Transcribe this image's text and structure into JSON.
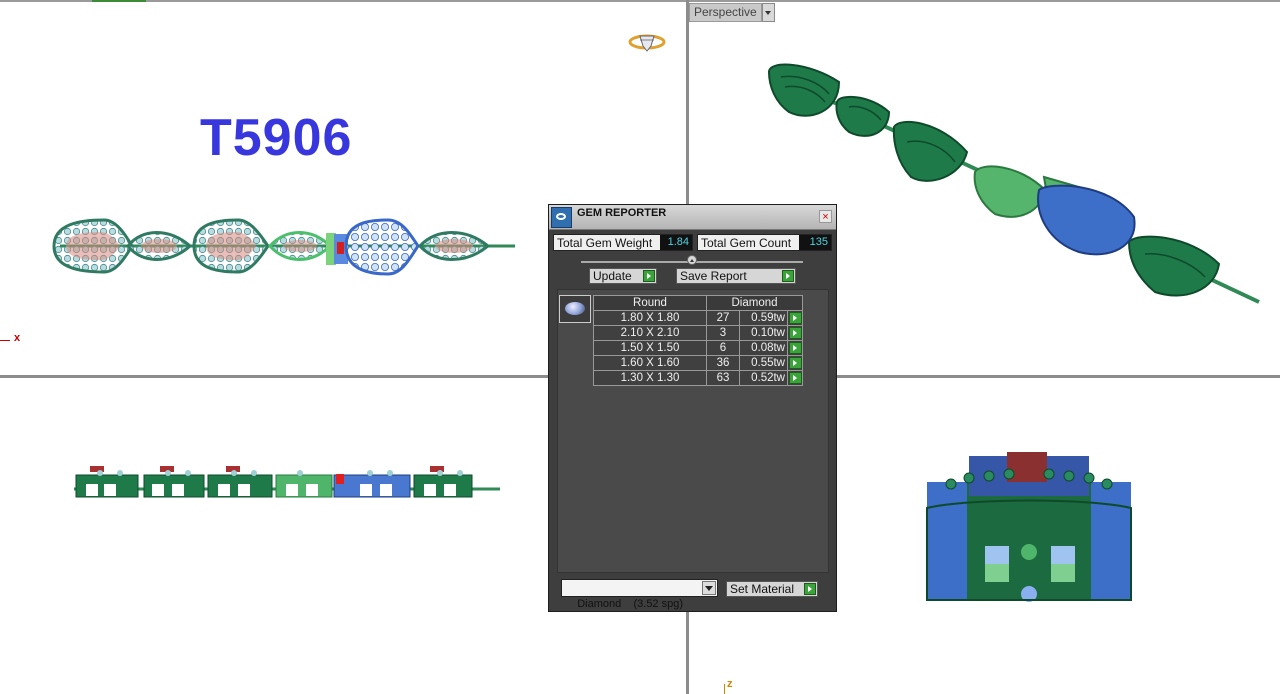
{
  "viewport_top_right": {
    "label": "Perspective"
  },
  "viewport_top_left": {
    "model_label": "T5906",
    "axis_label": "x"
  },
  "viewport_bottom_right": {
    "axis_label": "z"
  },
  "gem_reporter": {
    "title": "GEM REPORTER",
    "total_weight_label": "Total Gem Weight",
    "total_weight_value": "1.84",
    "total_count_label": "Total Gem Count",
    "total_count_value": "135",
    "update_label": "Update",
    "save_report_label": "Save Report",
    "table": {
      "shape_header": "Round",
      "material_header": "Diamond",
      "rows": [
        {
          "size": "1.80 X 1.80",
          "count": "27",
          "weight": "0.59tw"
        },
        {
          "size": "2.10 X 2.10",
          "count": "3",
          "weight": "0.10tw"
        },
        {
          "size": "1.50 X 1.50",
          "count": "6",
          "weight": "0.08tw"
        },
        {
          "size": "1.60 X 1.60",
          "count": "36",
          "weight": "0.55tw"
        },
        {
          "size": "1.30 X 1.30",
          "count": "63",
          "weight": "0.52tw"
        }
      ]
    },
    "material_select_value": "Diamond    (3.52 spg)",
    "set_material_label": "Set Material"
  }
}
